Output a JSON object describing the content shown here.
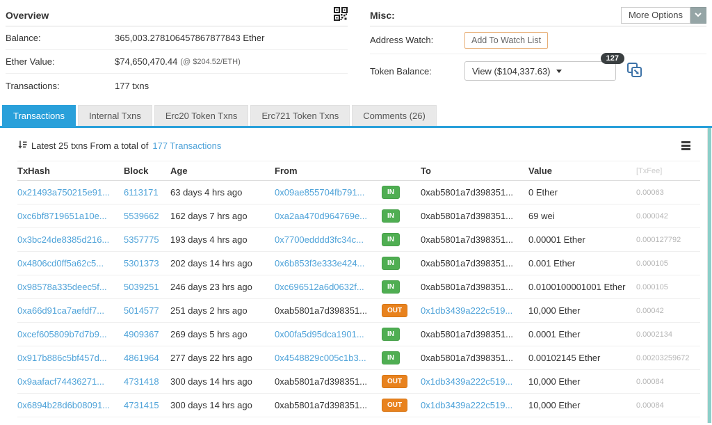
{
  "colors": {
    "link": "#4fa3d9",
    "tab-active": "#29a0da",
    "badge-in": "#4fae52",
    "badge-out": "#e8821e",
    "fee": "#b5b5b5",
    "watch-border": "#e7af77",
    "edge-strip": "#8ccfc9",
    "dark-badge": "#3a3f41",
    "more-gray": "#95a5a6",
    "icon-blue": "#3e73a8"
  },
  "overview": {
    "title": "Overview",
    "rows": [
      {
        "label": "Balance:",
        "value": "365,003.278106457867877843 Ether"
      },
      {
        "label": "Ether Value:",
        "value": "$74,650,470.44",
        "note": "(@ $204.52/ETH)"
      },
      {
        "label": "Transactions:",
        "value": "177 txns"
      }
    ]
  },
  "misc": {
    "title": "Misc:",
    "more_options_label": "More Options",
    "address_watch_label": "Address Watch:",
    "add_watch_button": "Add To Watch List",
    "token_balance_label": "Token Balance:",
    "token_balance_value": "View ($104,337.63)",
    "token_count_badge": "127"
  },
  "tabs": [
    {
      "label": "Transactions",
      "active": true
    },
    {
      "label": "Internal Txns",
      "active": false
    },
    {
      "label": "Erc20 Token Txns",
      "active": false
    },
    {
      "label": "Erc721 Token Txns",
      "active": false
    },
    {
      "label": "Comments (26)",
      "active": false
    }
  ],
  "table": {
    "summary_prefix": "Latest 25 txns From a total of",
    "summary_link": "177 Transactions",
    "headers": [
      "TxHash",
      "Block",
      "Age",
      "From",
      "To",
      "Value",
      "[TxFee]"
    ],
    "rows": [
      {
        "txhash": "0x21493a750215e91...",
        "block": "6113171",
        "age": "63 days 4 hrs ago",
        "from": "0x09ae855704fb791...",
        "dir": "IN",
        "to": "0xab5801a7d398351...",
        "value": "0 Ether",
        "fee": "0.00063"
      },
      {
        "txhash": "0xc6bf8719651a10e...",
        "block": "5539662",
        "age": "162 days 7 hrs ago",
        "from": "0xa2aa470d964769e...",
        "dir": "IN",
        "to": "0xab5801a7d398351...",
        "value": "69 wei",
        "fee": "0.000042"
      },
      {
        "txhash": "0x3bc24de8385d216...",
        "block": "5357775",
        "age": "193 days 4 hrs ago",
        "from": "0x7700edddd3fc34c...",
        "dir": "IN",
        "to": "0xab5801a7d398351...",
        "value": "0.00001 Ether",
        "fee": "0.000127792"
      },
      {
        "txhash": "0x4806cd0ff5a62c5...",
        "block": "5301373",
        "age": "202 days 14 hrs ago",
        "from": "0x6b853f3e333e424...",
        "dir": "IN",
        "to": "0xab5801a7d398351...",
        "value": "0.001 Ether",
        "fee": "0.000105"
      },
      {
        "txhash": "0x98578a335deec5f...",
        "block": "5039251",
        "age": "246 days 23 hrs ago",
        "from": "0xc696512a6d0632f...",
        "dir": "IN",
        "to": "0xab5801a7d398351...",
        "value": "0.0100100001001 Ether",
        "fee": "0.000105"
      },
      {
        "txhash": "0xa66d91ca7aefdf7...",
        "block": "5014577",
        "age": "251 days 2 hrs ago",
        "from": "0xab5801a7d398351...",
        "dir": "OUT",
        "to": "0x1db3439a222c519...",
        "value": "10,000 Ether",
        "fee": "0.00042"
      },
      {
        "txhash": "0xcef605809b7d7b9...",
        "block": "4909367",
        "age": "269 days 5 hrs ago",
        "from": "0x00fa5d95dca1901...",
        "dir": "IN",
        "to": "0xab5801a7d398351...",
        "value": "0.0001 Ether",
        "fee": "0.0002134"
      },
      {
        "txhash": "0x917b886c5bf457d...",
        "block": "4861964",
        "age": "277 days 22 hrs ago",
        "from": "0x4548829c005c1b3...",
        "dir": "IN",
        "to": "0xab5801a7d398351...",
        "value": "0.00102145 Ether",
        "fee": "0.00203259672"
      },
      {
        "txhash": "0x9aafacf74436271...",
        "block": "4731418",
        "age": "300 days 14 hrs ago",
        "from": "0xab5801a7d398351...",
        "dir": "OUT",
        "to": "0x1db3439a222c519...",
        "value": "10,000 Ether",
        "fee": "0.00084"
      },
      {
        "txhash": "0x6894b28d6b08091...",
        "block": "4731415",
        "age": "300 days 14 hrs ago",
        "from": "0xab5801a7d398351...",
        "dir": "OUT",
        "to": "0x1db3439a222c519...",
        "value": "10,000 Ether",
        "fee": "0.00084"
      }
    ]
  }
}
